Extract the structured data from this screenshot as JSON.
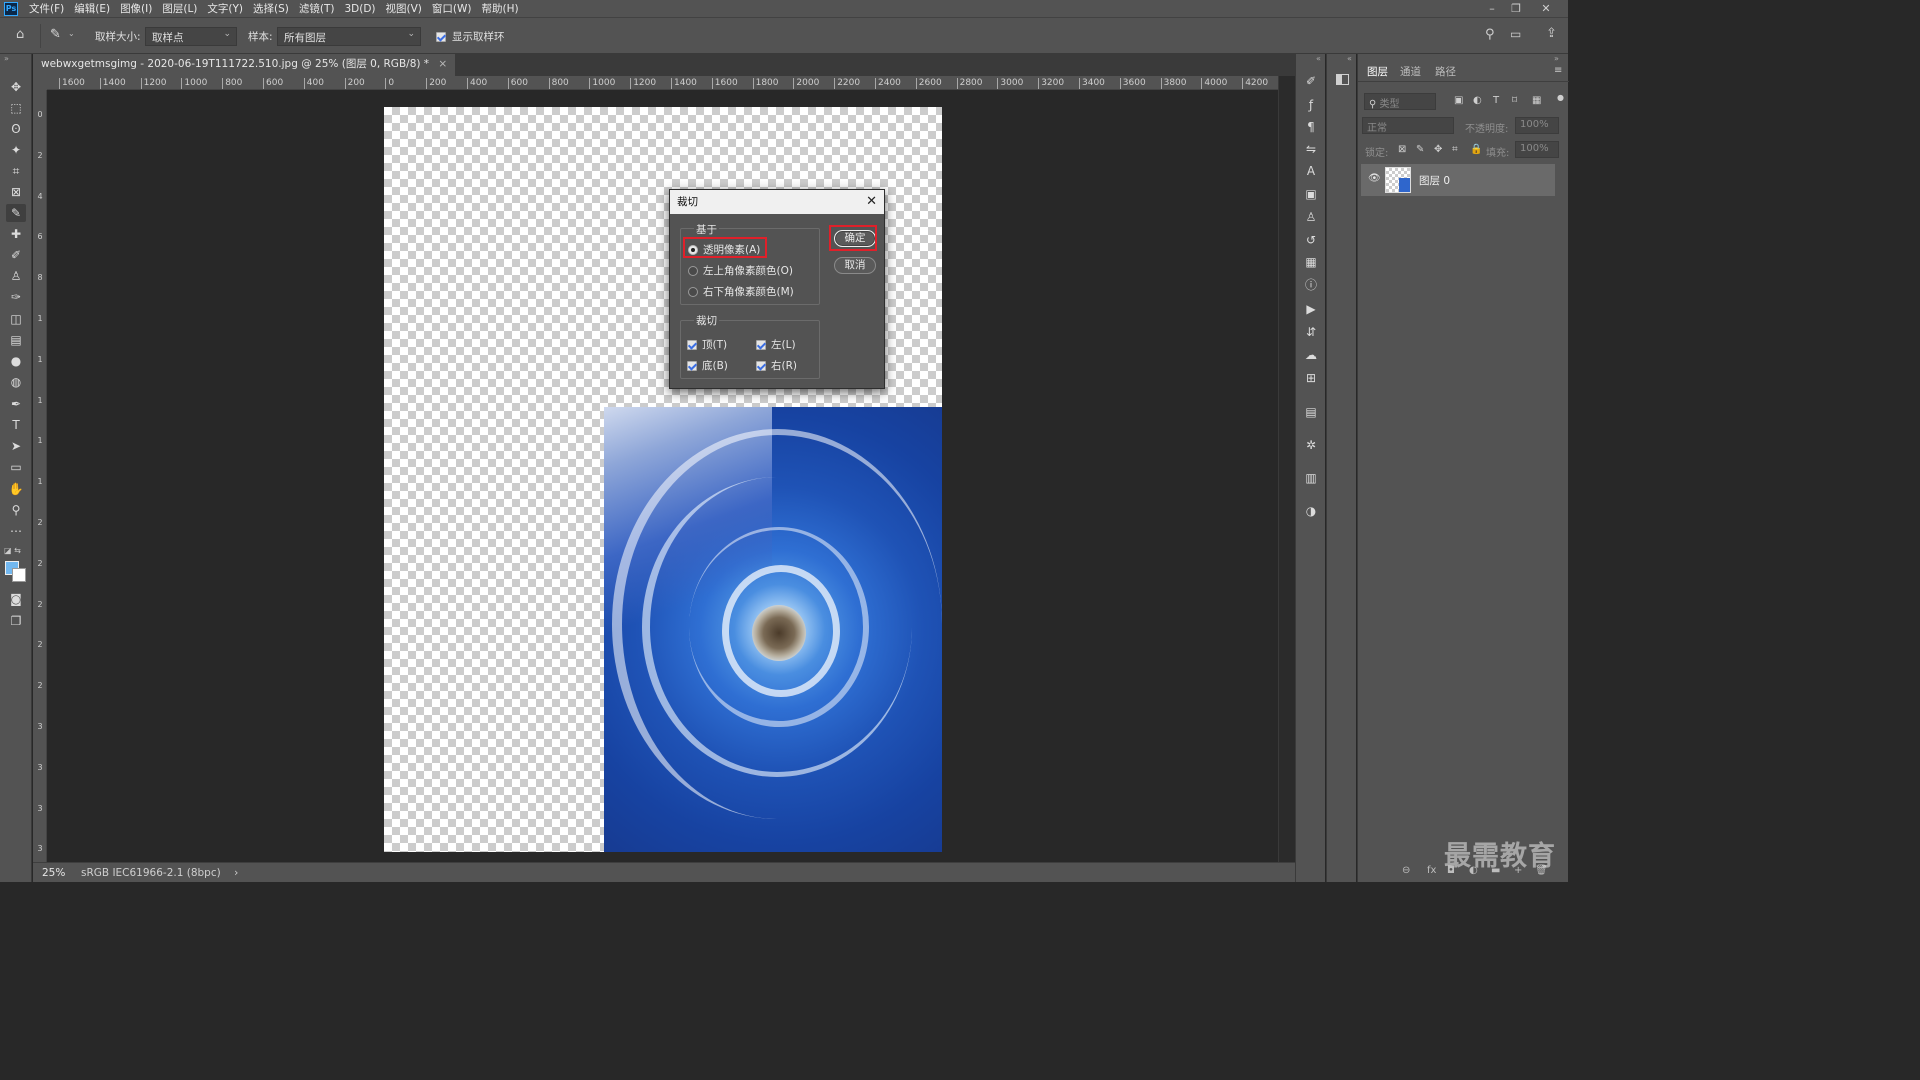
{
  "app": {
    "logo": "Ps"
  },
  "menu": [
    "文件(F)",
    "编辑(E)",
    "图像(I)",
    "图层(L)",
    "文字(Y)",
    "选择(S)",
    "滤镜(T)",
    "3D(D)",
    "视图(V)",
    "窗口(W)",
    "帮助(H)"
  ],
  "window_controls": {
    "minimize": "–",
    "restore": "❐",
    "close": "✕"
  },
  "options": {
    "sample_size_label": "取样大小:",
    "sample_size_value": "取样点",
    "sample_label": "样本:",
    "sample_value": "所有图层",
    "show_ring_label": "显示取样环",
    "show_ring_checked": true
  },
  "document": {
    "tab_title": "webwxgetmsgimg - 2020-06-19T111722.510.jpg @ 25% (图层 0, RGB/8) *",
    "tab_close": "×",
    "zoom": "25%",
    "profile": "sRGB IEC61966-2.1 (8bpc)",
    "status_arrow": "›"
  },
  "ruler": {
    "h_ticks": [
      "1600",
      "1400",
      "1200",
      "1000",
      "800",
      "600",
      "400",
      "200",
      "0",
      "200",
      "400",
      "600",
      "800",
      "1000",
      "1200",
      "1400",
      "1600",
      "1800",
      "2000",
      "2200",
      "2400",
      "2600",
      "2800",
      "3000",
      "3200",
      "3400",
      "3600",
      "3800",
      "4000",
      "4200"
    ],
    "v_ticks": [
      "0",
      "2",
      "4",
      "6",
      "8",
      "1",
      "1",
      "1",
      "1",
      "1",
      "2",
      "2",
      "2",
      "2",
      "2",
      "3",
      "3",
      "3",
      "3"
    ]
  },
  "dialog": {
    "title": "裁切",
    "close": "✕",
    "based_on_label": "基于",
    "options": [
      {
        "label": "透明像素(A)",
        "selected": true
      },
      {
        "label": "左上角像素颜色(O)",
        "selected": false
      },
      {
        "label": "右下角像素颜色(M)",
        "selected": false
      }
    ],
    "trim_away_label": "裁切",
    "checks": [
      {
        "label": "顶(T)",
        "checked": true
      },
      {
        "label": "左(L)",
        "checked": true
      },
      {
        "label": "底(B)",
        "checked": true
      },
      {
        "label": "右(R)",
        "checked": true
      }
    ],
    "ok": "确定",
    "cancel": "取消"
  },
  "layers_panel": {
    "tabs": [
      "图层",
      "通道",
      "路径"
    ],
    "active_tab": 0,
    "filter_placeholder": "类型",
    "blend_mode": "正常",
    "opacity_label": "不透明度:",
    "opacity_value": "100%",
    "lock_label": "锁定:",
    "fill_label": "填充:",
    "fill_value": "100%",
    "layers": [
      {
        "name": "图层 0",
        "visible": true
      }
    ],
    "bottom_icons": [
      "⊖",
      "fx",
      "◘",
      "◐",
      "▬",
      "+",
      "🗑"
    ]
  },
  "watermark": "最需教育",
  "colors": {
    "accent_red": "#e0202a",
    "ui_gray": "#535353",
    "canvas_bg": "#282828",
    "checkbox_blue": "#3b6ee3"
  }
}
